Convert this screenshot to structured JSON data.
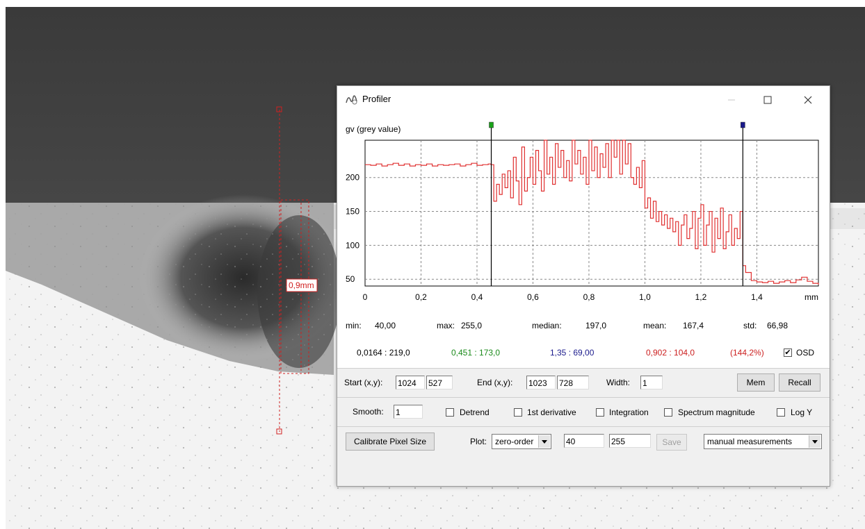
{
  "window": {
    "title": "Profiler",
    "min_icon": "minimize-icon",
    "max_icon": "maximize-icon",
    "close_icon": "close-icon"
  },
  "image_overlay": {
    "measure_label": "0,9mm"
  },
  "chart_data": {
    "type": "line",
    "title": "",
    "ylabel": "gv (grey value)",
    "xlabel": "mm",
    "xlim": [
      0,
      1.62
    ],
    "ylim": [
      40,
      255
    ],
    "xticks": [
      "0",
      "0,2",
      "0,4",
      "0,6",
      "0,8",
      "1,0",
      "1,2",
      "1,4"
    ],
    "xtick_values": [
      0,
      0.2,
      0.4,
      0.6,
      0.8,
      1.0,
      1.2,
      1.4
    ],
    "yticks": [
      "50",
      "100",
      "150",
      "200"
    ],
    "ytick_values": [
      50,
      100,
      150,
      200
    ],
    "grid": true,
    "cursor_lines": [
      {
        "x": 0.451,
        "marker_color": "#1aa31a"
      },
      {
        "x": 1.35,
        "marker_color": "#1a1a8c"
      }
    ],
    "series": [
      {
        "color": "#e03030",
        "x": [
          0,
          0.02,
          0.04,
          0.06,
          0.08,
          0.1,
          0.12,
          0.14,
          0.16,
          0.18,
          0.2,
          0.22,
          0.24,
          0.26,
          0.28,
          0.3,
          0.32,
          0.34,
          0.36,
          0.38,
          0.4,
          0.42,
          0.44,
          0.45,
          0.46,
          0.47,
          0.48,
          0.49,
          0.5,
          0.51,
          0.52,
          0.53,
          0.54,
          0.55,
          0.56,
          0.57,
          0.58,
          0.59,
          0.6,
          0.61,
          0.62,
          0.63,
          0.64,
          0.65,
          0.66,
          0.67,
          0.68,
          0.69,
          0.7,
          0.71,
          0.72,
          0.73,
          0.74,
          0.75,
          0.76,
          0.77,
          0.78,
          0.79,
          0.8,
          0.81,
          0.82,
          0.83,
          0.84,
          0.85,
          0.86,
          0.87,
          0.88,
          0.89,
          0.9,
          0.91,
          0.92,
          0.93,
          0.94,
          0.95,
          0.96,
          0.97,
          0.98,
          0.99,
          1.0,
          1.01,
          1.02,
          1.03,
          1.04,
          1.05,
          1.06,
          1.07,
          1.08,
          1.09,
          1.1,
          1.11,
          1.12,
          1.13,
          1.14,
          1.15,
          1.16,
          1.17,
          1.18,
          1.19,
          1.2,
          1.21,
          1.22,
          1.23,
          1.24,
          1.25,
          1.26,
          1.27,
          1.28,
          1.29,
          1.3,
          1.31,
          1.32,
          1.33,
          1.34,
          1.35,
          1.36,
          1.38,
          1.4,
          1.42,
          1.44,
          1.46,
          1.48,
          1.5,
          1.52,
          1.54,
          1.56,
          1.58,
          1.6,
          1.62
        ],
        "values": [
          219,
          218,
          220,
          217,
          219,
          221,
          218,
          220,
          217,
          219,
          218,
          220,
          217,
          219,
          218,
          219,
          220,
          217,
          219,
          221,
          218,
          219,
          220,
          219,
          165,
          190,
          175,
          205,
          185,
          210,
          170,
          230,
          195,
          160,
          245,
          180,
          200,
          230,
          190,
          240,
          210,
          180,
          255,
          205,
          230,
          190,
          250,
          215,
          240,
          200,
          225,
          195,
          255,
          220,
          240,
          205,
          230,
          190,
          255,
          210,
          245,
          200,
          235,
          215,
          250,
          200,
          255,
          230,
          255,
          205,
          255,
          220,
          250,
          200,
          190,
          215,
          185,
          225,
          155,
          170,
          140,
          165,
          135,
          150,
          130,
          145,
          125,
          140,
          120,
          135,
          100,
          130,
          145,
          110,
          125,
          150,
          95,
          140,
          160,
          100,
          130,
          150,
          90,
          140,
          110,
          155,
          95,
          120,
          145,
          100,
          125,
          110,
          150,
          70,
          60,
          48,
          46,
          45,
          47,
          44,
          46,
          48,
          45,
          49,
          53,
          47,
          44,
          42
        ]
      }
    ]
  },
  "stats": {
    "min_label": "min:",
    "min_value": "40,00",
    "max_label": "max:",
    "max_value": "255,0",
    "median_label": "median:",
    "median_value": "197,0",
    "mean_label": "mean:",
    "mean_value": "167,4",
    "std_label": "std:",
    "std_value": "66,98"
  },
  "osd": {
    "p0": "0,0164  :  219,0",
    "p1": "0,451  :  173,0",
    "p2": "1,35  :  69,00",
    "p3": "0,902  :  104,0",
    "pct": "(144,2%)",
    "osd_label": "OSD",
    "colors": {
      "p0": "#000000",
      "p1": "#1a8a1a",
      "p2": "#1a1a8c",
      "p3": "#cc2020",
      "pct": "#cc2020"
    }
  },
  "coords": {
    "start_label": "Start (x,y):",
    "start_x": "1024",
    "start_y": "527",
    "end_label": "End (x,y):",
    "end_x": "1023",
    "end_y": "728",
    "width_label": "Width:",
    "width_value": "1",
    "mem_label": "Mem",
    "recall_label": "Recall"
  },
  "options": {
    "smooth_label": "Smooth:",
    "smooth_value": "1",
    "detrend_label": "Detrend",
    "deriv_label": "1st derivative",
    "integration_label": "Integration",
    "spectrum_label": "Spectrum magnitude",
    "logy_label": "Log Y"
  },
  "bottom": {
    "calibrate_label": "Calibrate Pixel Size",
    "plot_label": "Plot:",
    "plot_value": "zero-order",
    "min_value": "40",
    "max_value": "255",
    "save_label": "Save",
    "mode_value": "manual measurements"
  }
}
